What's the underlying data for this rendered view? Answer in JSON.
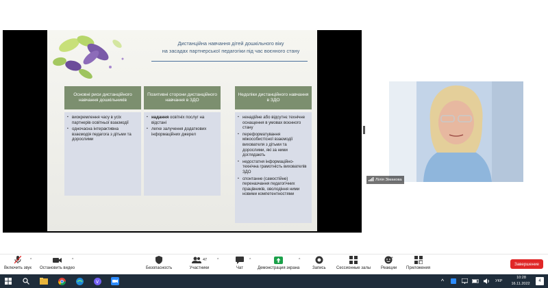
{
  "slide": {
    "title_line1": "Дистанційна навчання дітей дошкільного віку",
    "title_line2": "на засадах партнерської педагогіки під час воєнного стану",
    "columns": [
      {
        "header": "Основні риси дистанційного навчання дошкільників",
        "items": [
          "виокремлення часу в усіх партнерів освітньої взаємодії",
          "одночасна інтерактивна взаємодія педагога з дітьми та дорослими"
        ]
      },
      {
        "header": "Позитивні сторони дистанційного навчання в ЗДО",
        "items_rich": [
          {
            "bold": "надання",
            "rest": " освітніх послуг на відстані"
          },
          {
            "bold": "",
            "rest": "легке залучення додаткових інформаційних джерел"
          }
        ]
      },
      {
        "header": "Недоліки дистанційного навчання в ЗДО",
        "items": [
          "ненадійне або відсутнє технічне оснащення в умовах воєнного стану",
          "переформатування міжособистісної взаємодії вихователя з дітьми та дорослими, які за ними доглядають",
          "недостатня інформаційно-технічна грамотність вихователів ЗДО",
          "спонтанне (самостійне) переназчання педагогічних працівників, оволодіння ними новими компетентностями"
        ]
      }
    ]
  },
  "video": {
    "participant_name": "Лілія Зімакова"
  },
  "toolbar": {
    "mute": "Включить звук",
    "stop_video": "Остановить видео",
    "security": "Безопасность",
    "participants": "Участники",
    "participants_count": "47",
    "chat": "Чат",
    "share": "Демонстрация экрана",
    "record": "Запись",
    "breakout": "Сессионные залы",
    "reactions": "Реакции",
    "apps": "Приложения",
    "end": "Завершение"
  },
  "taskbar": {
    "lang": "УКР",
    "time": "10:28",
    "date": "16.11.2022",
    "notifications": "4"
  },
  "colors": {
    "column_header": "#7c8f6f",
    "column_body": "#d9dde8",
    "share_active": "#1ba14a",
    "end_button": "#e02828",
    "taskbar": "#1f2d3b"
  }
}
